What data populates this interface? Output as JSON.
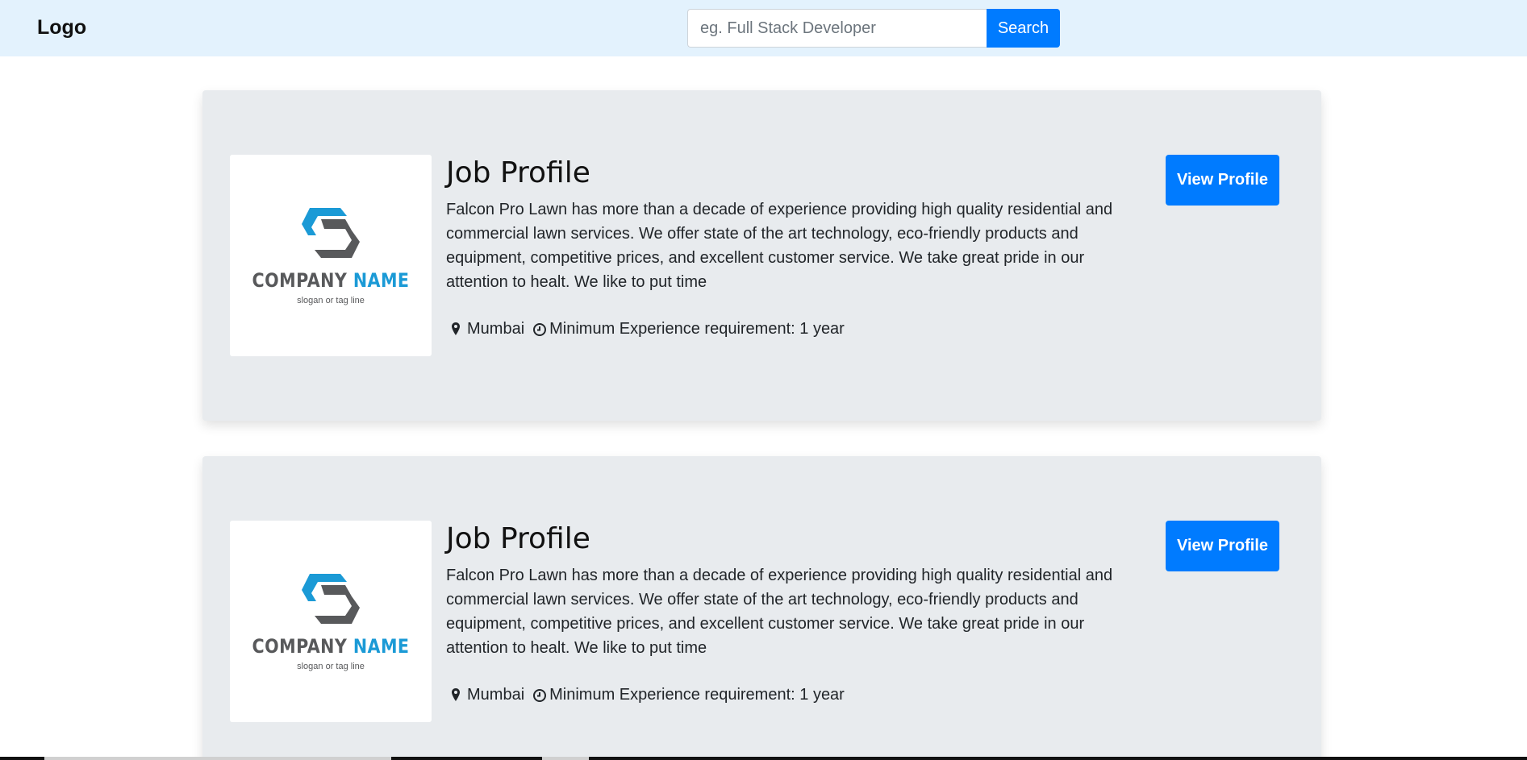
{
  "navbar": {
    "brand": "Logo",
    "search_placeholder": "eg. Full Stack Developer",
    "search_value": "",
    "search_button": "Search"
  },
  "colors": {
    "navbar_bg": "#e3f2fd",
    "primary": "#007bff",
    "card_bg": "#e8ebee",
    "logo_blue": "#1b9ad6",
    "logo_gray": "#58595b"
  },
  "jobs": [
    {
      "title": "Job Profile",
      "company_name_part1": "COMPANY",
      "company_name_part2": "NAME",
      "slogan": "slogan or tag line",
      "description": "Falcon Pro Lawn has more than a decade of experience providing high quality residential and commercial lawn services. We offer state of the art technology, eco-friendly products and equipment, competitive prices, and excellent customer service.  We take great pride in our attention to healt.  We like to put time",
      "location_icon": "map-marker-icon",
      "location": "Mumbai",
      "experience_icon": "clock-icon",
      "experience": "Minimum Experience requirement: 1 year",
      "button": "View Profile"
    },
    {
      "title": "Job Profile",
      "company_name_part1": "COMPANY",
      "company_name_part2": "NAME",
      "slogan": "slogan or tag line",
      "description": "Falcon Pro Lawn has more than a decade of experience providing high quality residential and commercial lawn services. We offer state of the art technology, eco-friendly products and equipment, competitive prices, and excellent customer service.  We take great pride in our attention to healt.  We like to put time",
      "location_icon": "map-marker-icon",
      "location": "Mumbai",
      "experience_icon": "clock-icon",
      "experience": "Minimum Experience requirement: 1 year",
      "button": "View Profile"
    }
  ]
}
